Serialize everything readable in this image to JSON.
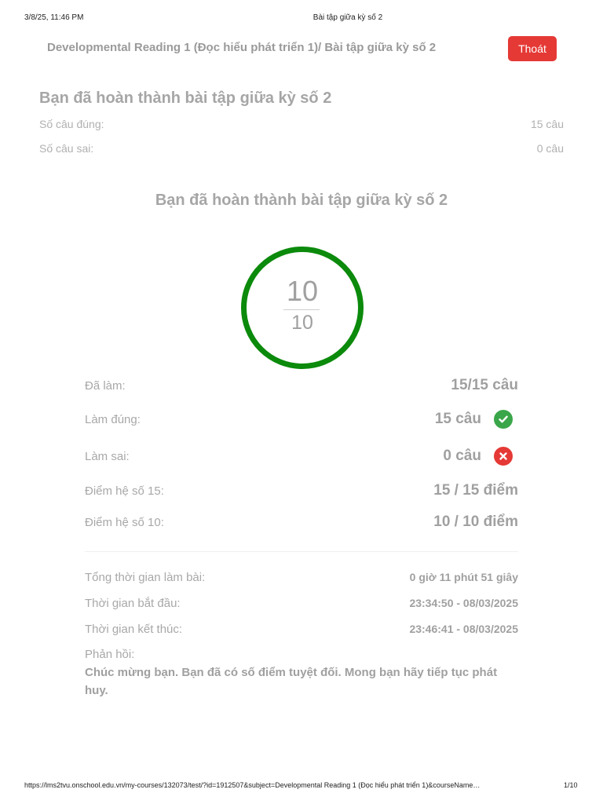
{
  "print_header": {
    "datetime": "3/8/25, 11:46 PM",
    "doc_title": "Bài tập giữa kỳ số 2"
  },
  "topbar": {
    "breadcrumb": "Developmental Reading 1 (Đọc hiểu phát triển 1)/ Bài tập giữa kỳ số 2",
    "exit_label": "Thoát"
  },
  "summary": {
    "title": "Bạn đã hoàn thành bài tập giữa kỳ số 2",
    "correct_label": "Số câu đúng:",
    "correct_value": "15 câu",
    "wrong_label": "Số câu sai:",
    "wrong_value": "0 câu"
  },
  "result": {
    "title": "Bạn đã hoàn thành bài tập giữa kỳ số 2",
    "score": "10",
    "score_max": "10",
    "ring_color": "#0b8a0b"
  },
  "stats": [
    {
      "label": "Đã làm:",
      "value": "15/15 câu",
      "icon": ""
    },
    {
      "label": "Làm đúng:",
      "value": "15 câu",
      "icon": "check-circle-icon",
      "icon_color": "#3aa64a"
    },
    {
      "label": "Làm sai:",
      "value": "0 câu",
      "icon": "x-circle-icon",
      "icon_color": "#e53935"
    },
    {
      "label": "Điểm hệ số 15:",
      "value": "15 / 15 điểm",
      "icon": ""
    },
    {
      "label": "Điểm hệ số 10:",
      "value": "10 / 10 điểm",
      "icon": ""
    }
  ],
  "timing": {
    "total_label": "Tổng thời gian làm bài:",
    "total_value": "0 giờ 11 phút 51 giây",
    "start_label": "Thời gian bắt đầu:",
    "start_value": "23:34:50 - 08/03/2025",
    "end_label": "Thời gian kết thúc:",
    "end_value": "23:46:41 - 08/03/2025"
  },
  "feedback": {
    "label": "Phản hồi:",
    "text": "Chúc mừng bạn. Bạn đã có số điểm tuyệt đối. Mong bạn hãy tiếp tục phát huy."
  },
  "print_footer": {
    "url": "https://lms2tvu.onschool.edu.vn/my-courses/132073/test/?id=1912507&subject=Developmental Reading 1 (Đọc hiểu phát triển 1)&courseName…",
    "page": "1/10"
  },
  "colors": {
    "exit_button": "#e53935",
    "accent_green": "#0b8a0b"
  }
}
